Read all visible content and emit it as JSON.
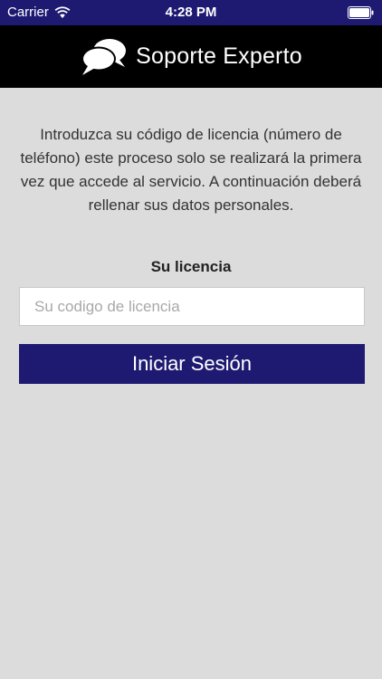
{
  "status_bar": {
    "carrier": "Carrier",
    "time": "4:28 PM"
  },
  "nav": {
    "title": "Soporte Experto",
    "logo_icon": "chat-bubbles-icon"
  },
  "content": {
    "intro": "Introduzca su código de licencia (número de teléfono) este proceso solo se realizará la primera vez que accede al servicio. A continuación deberá rellenar sus datos personales.",
    "license_label": "Su licencia",
    "license_placeholder": "Su codigo de licencia",
    "license_value": "",
    "login_button": "Iniciar Sesión"
  },
  "colors": {
    "accent": "#1e1a72",
    "nav_background": "#000000",
    "page_background": "#dcdcdc"
  }
}
